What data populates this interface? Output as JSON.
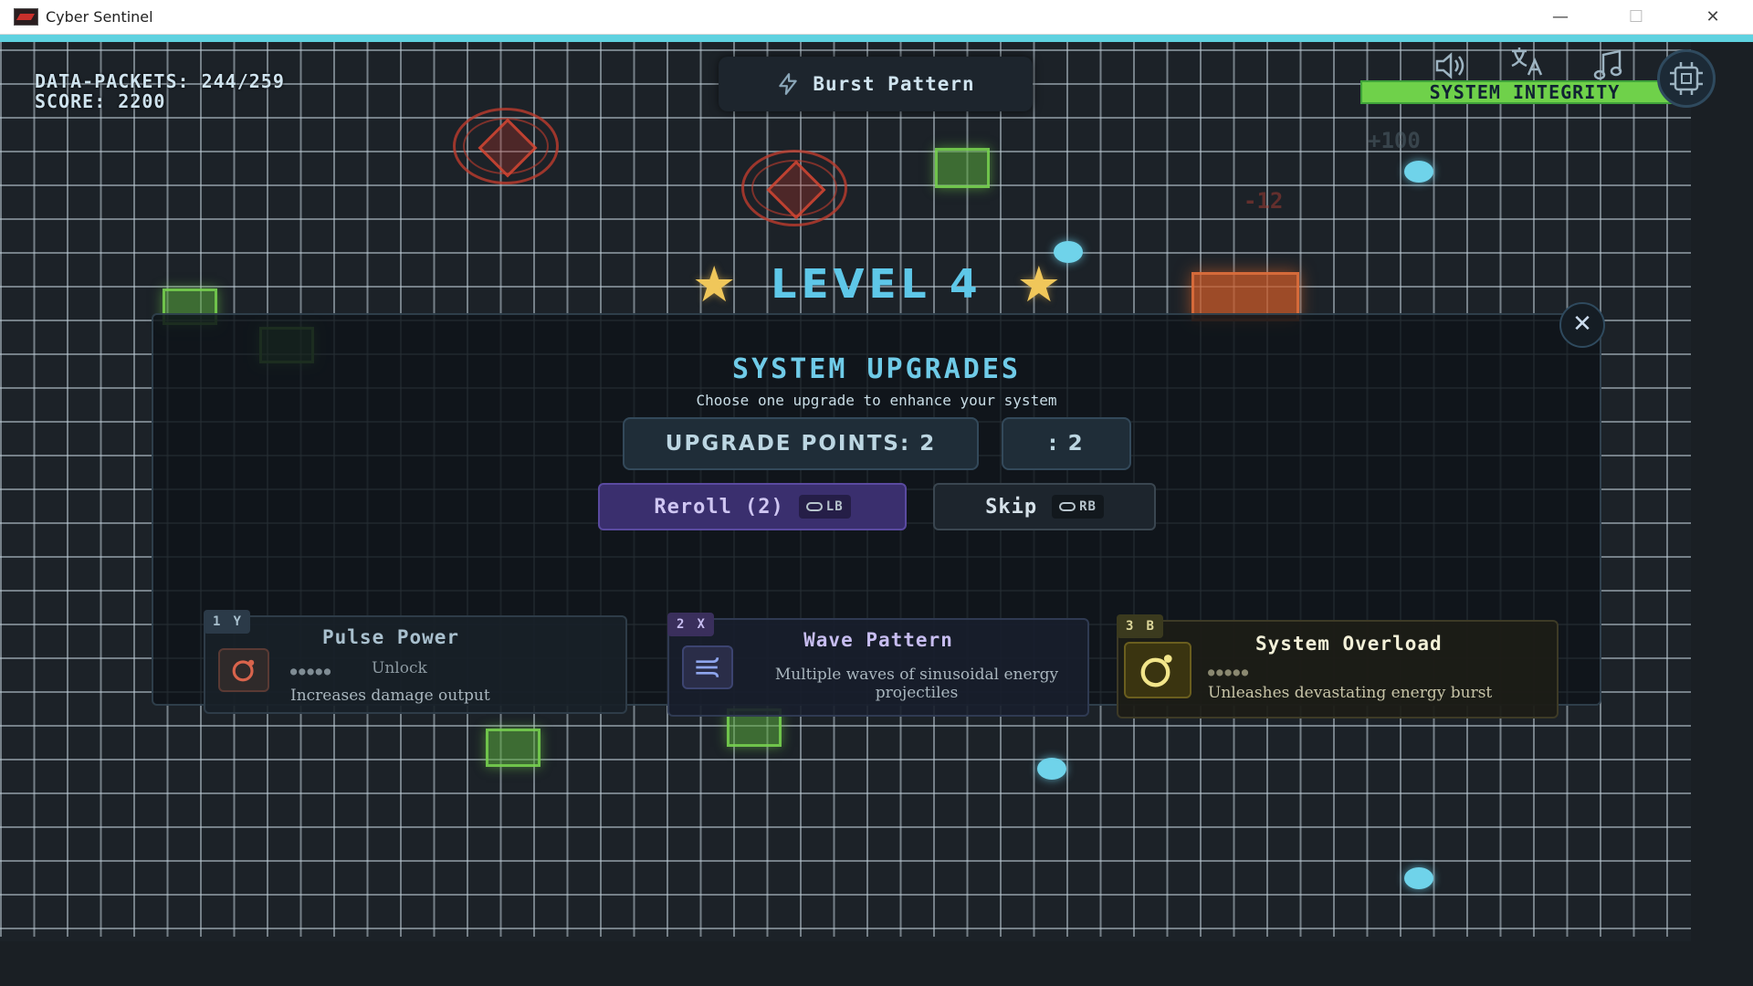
{
  "window": {
    "title": "Cyber Sentinel",
    "minimize": "—",
    "maximize": "☐",
    "close": "✕"
  },
  "hud": {
    "data_packets_line": "DATA-PACKETS: 244/259",
    "score_line": "SCORE: 2200",
    "burst_pattern": "Burst Pattern",
    "system_integrity": "SYSTEM INTEGRITY",
    "integrity_level": 1.0,
    "icons": [
      "volume-icon",
      "translate-icon",
      "music-icon",
      "settings-chip-icon"
    ]
  },
  "floating_text": {
    "plus": "+100",
    "minus": "-12"
  },
  "level_banner": {
    "text": "LEVEL 4",
    "star_left": "★",
    "star_right": "★"
  },
  "upgrade_modal": {
    "title": "SYSTEM UPGRADES",
    "subtitle": "Choose one upgrade to enhance your system",
    "points_label": "UPGRADE POINTS: 2",
    "points_secondary": ": 2",
    "reroll_label": "Reroll (2)",
    "reroll_hint": "LB",
    "skip_label": "Skip",
    "skip_hint": "RB",
    "close_label": "✕",
    "cards": [
      {
        "index": "1",
        "key": "Y",
        "name": "Pulse Power",
        "pips": "●●●●●",
        "status": "Unlock",
        "description": "Increases damage output",
        "accent": "#a9c0ce"
      },
      {
        "index": "2",
        "key": "X",
        "name": "Wave Pattern",
        "description": "Multiple waves of sinusoidal energy projectiles",
        "accent": "#c7bdf0"
      },
      {
        "index": "3",
        "key": "B",
        "name": "System Overload",
        "pips": "●●●●●",
        "description": "Unleashes devastating energy burst",
        "accent": "#f2e58a"
      }
    ]
  },
  "colors": {
    "accent_cyan": "#5fd2e0",
    "level_blue": "#5ec7e8",
    "integrity_green": "#6fd14a",
    "enemy_red": "#be3c2d",
    "packet_green": "#78d250",
    "star_gold": "#f0c75a"
  }
}
